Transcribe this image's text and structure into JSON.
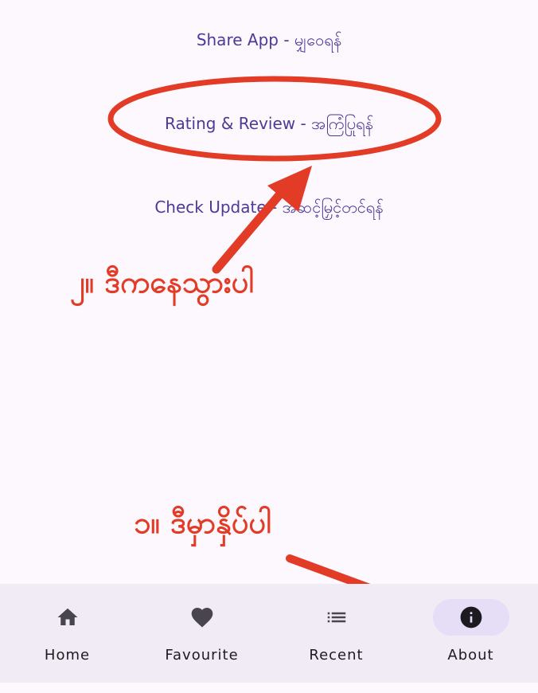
{
  "menu": {
    "share": "Share App - မျှဝေရန်",
    "rating": "Rating & Review - အကြံပြုရန်",
    "update": "Check Update - အဆင့်မြှင့်တင်ရန်"
  },
  "annotations": {
    "step2": "၂။ ဒီကနေသွားပါ",
    "step1": "၁။ ဒီမှာနှိပ်ပါ",
    "color": "#e23b26"
  },
  "nav": {
    "active": "about",
    "items": [
      {
        "id": "home",
        "label": "Home",
        "icon": "home-icon"
      },
      {
        "id": "favourite",
        "label": "Favourite",
        "icon": "heart-icon"
      },
      {
        "id": "recent",
        "label": "Recent",
        "icon": "list-icon"
      },
      {
        "id": "about",
        "label": "About",
        "icon": "info-icon"
      }
    ]
  },
  "colors": {
    "background": "#fdf7fe",
    "link": "#4b3a96",
    "nav_background": "#f0ebf4",
    "nav_active_pill": "#e6ddf6",
    "annotation": "#e23b26"
  }
}
